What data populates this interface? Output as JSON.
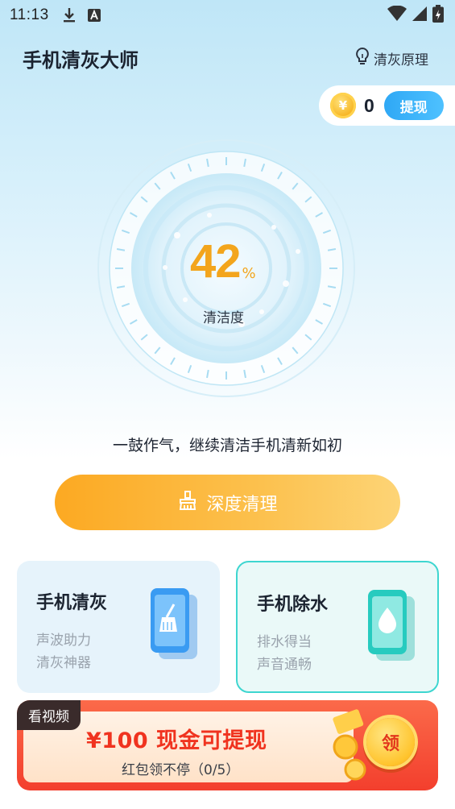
{
  "status_bar": {
    "time": "11:13"
  },
  "header": {
    "title": "手机清灰大师",
    "principle_label": "清灰原理"
  },
  "wallet": {
    "coin_symbol": "¥",
    "coins": "0",
    "withdraw_label": "提现"
  },
  "gauge": {
    "value": "42",
    "unit": "%",
    "label": "清洁度",
    "percent": 42
  },
  "slogan": "一鼓作气，继续清洁手机清新如初",
  "deep_clean": {
    "label": "深度清理"
  },
  "features": [
    {
      "title": "手机清灰",
      "line1": "声波助力",
      "line2": "清灰神器",
      "icon": "broom-phone-icon"
    },
    {
      "title": "手机除水",
      "line1": "排水得当",
      "line2": "声音通畅",
      "icon": "water-drop-phone-icon"
    }
  ],
  "banner": {
    "tag": "看视频",
    "title": "¥100 现金可提现",
    "subtitle": "红包领不停（0/5）",
    "claim_label": "领"
  },
  "colors": {
    "accent_orange": "#f3a51c",
    "accent_blue": "#2fa8f5",
    "accent_teal": "#3ed6d0",
    "banner_red": "#f33f2d"
  }
}
